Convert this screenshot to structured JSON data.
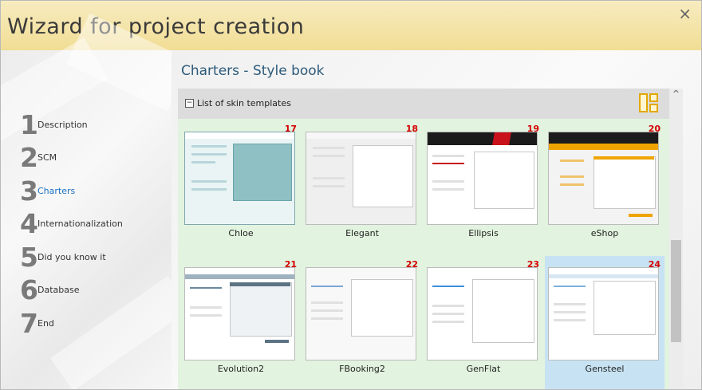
{
  "window": {
    "title": "Wizard for project creation",
    "close_label": "×"
  },
  "steps": [
    {
      "number": "1",
      "label": "Description",
      "active": false
    },
    {
      "number": "2",
      "label": "SCM",
      "active": false
    },
    {
      "number": "3",
      "label": "Charters",
      "active": true
    },
    {
      "number": "4",
      "label": "Internationalization",
      "active": false
    },
    {
      "number": "5",
      "label": "Did you know it",
      "active": false
    },
    {
      "number": "6",
      "label": "Database",
      "active": false
    },
    {
      "number": "7",
      "label": "End",
      "active": false
    }
  ],
  "main": {
    "heading": "Charters - Style book",
    "list": {
      "collapse_label": "−",
      "title": "List of skin templates",
      "templates": [
        {
          "number": "17",
          "name": "Chloe",
          "selected": false
        },
        {
          "number": "18",
          "name": "Elegant",
          "selected": false
        },
        {
          "number": "19",
          "name": "Ellipsis",
          "selected": false
        },
        {
          "number": "20",
          "name": "eShop",
          "selected": false
        },
        {
          "number": "21",
          "name": "Evolution2",
          "selected": false
        },
        {
          "number": "22",
          "name": "FBooking2",
          "selected": false
        },
        {
          "number": "23",
          "name": "GenFlat",
          "selected": false
        },
        {
          "number": "24",
          "name": "Gensteel",
          "selected": true
        }
      ]
    },
    "scroll_up_label": "^"
  },
  "colors": {
    "title_bar": "#f1dd94",
    "active_step": "#1b6fc2",
    "list_background": "#e2f3df",
    "selection": "#c7e3f3",
    "template_number": "#d40000",
    "layout_icon": "#e3a700"
  }
}
